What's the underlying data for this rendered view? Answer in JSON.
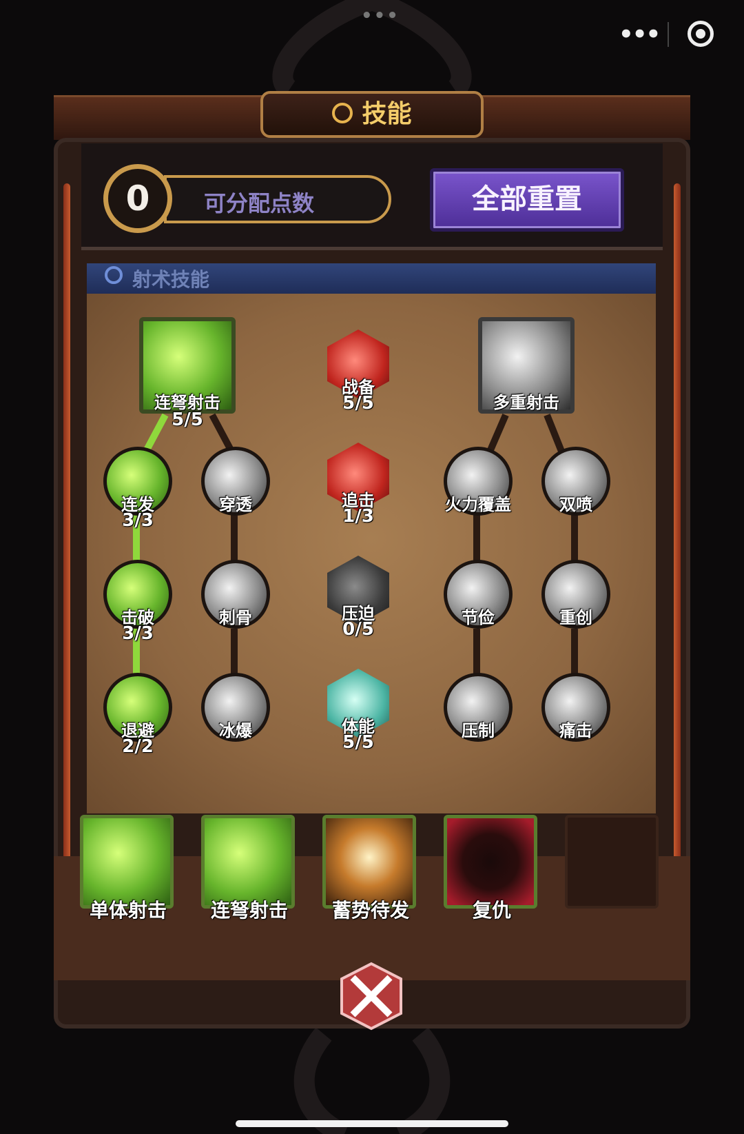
{
  "system": {
    "more_dots": "•••",
    "capsule_more": "•••"
  },
  "header": {
    "title": "技能"
  },
  "points": {
    "value": "0",
    "label": "可分配点数"
  },
  "reset": {
    "label": "全部重置"
  },
  "section": {
    "title": "射术技能"
  },
  "tree": {
    "left_top": {
      "name": "连弩射击",
      "count": "5/5"
    },
    "right_top": {
      "name": "多重射击"
    },
    "center": [
      {
        "name": "战备",
        "count": "5/5"
      },
      {
        "name": "追击",
        "count": "1/3"
      },
      {
        "name": "压迫",
        "count": "0/5"
      },
      {
        "name": "体能",
        "count": "5/5"
      }
    ],
    "col1": [
      {
        "name": "连发",
        "count": "3/3"
      },
      {
        "name": "击破",
        "count": "3/3"
      },
      {
        "name": "退避",
        "count": "2/2"
      }
    ],
    "col2": [
      {
        "name": "穿透"
      },
      {
        "name": "刺骨"
      },
      {
        "name": "冰爆"
      }
    ],
    "col4": [
      {
        "name": "火力覆盖"
      },
      {
        "name": "节俭"
      },
      {
        "name": "压制"
      }
    ],
    "col5": [
      {
        "name": "双喷"
      },
      {
        "name": "重创"
      },
      {
        "name": "痛击"
      }
    ]
  },
  "slots": [
    {
      "label": "单体射击"
    },
    {
      "label": "连弩射击"
    },
    {
      "label": "蓄势待发"
    },
    {
      "label": "复仇"
    }
  ],
  "colors": {
    "accent_gold": "#c99a4c",
    "reset_purple": "#6a48b8",
    "active_green": "#8fd83c"
  }
}
